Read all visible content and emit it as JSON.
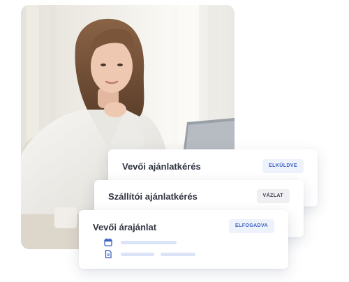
{
  "cards": [
    {
      "title": "Vevői ajánlatkérés",
      "status": "ELKÜLDVE"
    },
    {
      "title": "Szállítói ajánlatkérés",
      "status": "VÁZLAT"
    },
    {
      "title": "Vevői árajánlat",
      "status": "ELFOGADVA"
    }
  ],
  "icons": {
    "row1": "calendar-icon",
    "row2": "document-icon"
  },
  "colors": {
    "accent": "#3e63c4",
    "badge_blue_bg": "#eef2fb",
    "badge_gray_bg": "#f0f0f2",
    "title_text": "#2f3440",
    "placeholder": "#dbe3f6"
  }
}
